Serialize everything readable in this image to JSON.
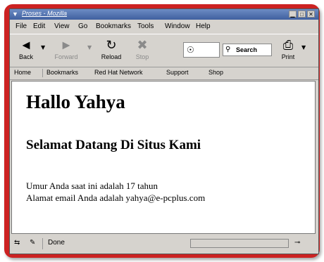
{
  "window": {
    "title": "Proses - Mozilla",
    "controls": {
      "minimize": "▁",
      "maximize": "□",
      "close": "✕"
    }
  },
  "menu": [
    "File",
    "Edit",
    "View",
    "Go",
    "Bookmarks",
    "Tools",
    "Window",
    "Help"
  ],
  "toolbar": {
    "back": "Back",
    "forward": "Forward",
    "reload": "Reload",
    "stop": "Stop",
    "search": "Search",
    "print": "Print"
  },
  "personal_bar": [
    "Home",
    "Bookmarks",
    "Red Hat Network",
    "Support",
    "Shop"
  ],
  "page": {
    "heading": "Hallo Yahya",
    "subheading": "Selamat Datang Di Situs Kami",
    "line1": "Umur Anda saat ini adalah 17 tahun",
    "line2": "Alamat email Anda adalah yahya@e-pcplus.com"
  },
  "statusbar": {
    "text": "Done"
  },
  "icons": [
    "back-icon",
    "forward-icon",
    "reload-icon",
    "stop-icon",
    "url-icon",
    "search-icon",
    "print-icon"
  ],
  "colors": {
    "frame": "#cc2222",
    "titlebar": "#3f5f9f",
    "chrome": "#d6d3ce"
  }
}
